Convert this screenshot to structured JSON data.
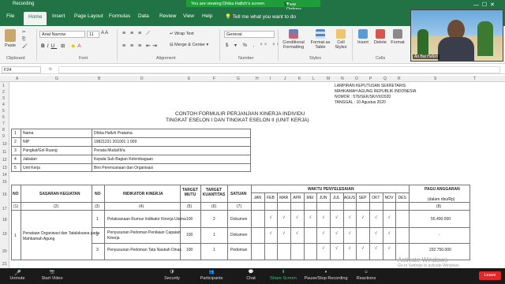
{
  "zoom": {
    "recording": "Recording",
    "banner": "You are viewing Dhika Hafizh's screen",
    "view_options": "View Options",
    "participant_name": "Ari Bai Hafizh",
    "toolbar": [
      "Unmute",
      "Start Video",
      "Security",
      "Participants",
      "Chat",
      "Share Screen",
      "Pause/Stop Recording",
      "Reactions"
    ],
    "participants_count": "1",
    "leave": "Leave"
  },
  "excel": {
    "tabs": [
      "File",
      "Home",
      "Insert",
      "Page Layout",
      "Formulas",
      "Data",
      "Review",
      "View",
      "Help"
    ],
    "tell_me": "Tell me what you want to do",
    "clipboard": {
      "paste": "Paste",
      "group": "Clipboard"
    },
    "font": {
      "name": "Arial Narrow",
      "size": "11",
      "group": "Font"
    },
    "alignment": {
      "wrap": "Wrap Text",
      "merge": "Merge & Center",
      "group": "Alignment"
    },
    "number": {
      "format": "General",
      "group": "Number"
    },
    "styles": {
      "cond": "Conditional Formatting",
      "table": "Format as Table",
      "cell": "Cell Styles",
      "group": "Styles"
    },
    "cells": {
      "insert": "Insert",
      "delete": "Delete",
      "format": "Format",
      "group": "Cells"
    },
    "namebox": "F24",
    "fx": "fx",
    "columns": [
      "A",
      "G",
      "B",
      "C",
      "D",
      "E",
      "F",
      "G",
      "H",
      "I",
      "J",
      "K",
      "L",
      "M",
      "N",
      "O",
      "P",
      "Q",
      "R",
      "S",
      "T",
      "U",
      "V"
    ],
    "rows": [
      "1",
      "2",
      "3",
      "4",
      "5",
      "6",
      "7",
      "8",
      "9",
      "10",
      "11",
      "12",
      "13",
      "14",
      "15",
      "16",
      "17",
      "18",
      "19",
      "20",
      "21"
    ]
  },
  "doc": {
    "lampiran": [
      "LAMPIRAN KEPUTUSAN SEKRETARIS",
      "MAHKAMAH AGUNG REPUBLIK INDONESIA",
      "NOMOR : 576/SEK/SK/VII/2020",
      "TANGGAL : 10 Agustus 2020"
    ],
    "title1": "CONTOH FORMULIR PERJANJIAN KINERJA INDIVIDU",
    "title2": "TINGKAT ESELON I DAN TINGKAT ESELON II (UNIT KERJA)",
    "info": [
      {
        "no": "1",
        "label": "Nama",
        "value": "Dhika Hafizh Pratama"
      },
      {
        "no": "2",
        "label": "NIP",
        "value": "19821231 201001 1 009"
      },
      {
        "no": "3",
        "label": "Pangkat/Gol Ruang",
        "value": "Penata Muda/III/a"
      },
      {
        "no": "4",
        "label": "Jabatan",
        "value": "Kepala Sub Bagian Kelembagaan"
      },
      {
        "no": "5",
        "label": "Unit Kerja",
        "value": "Biro Perencanaan dan Organisasi"
      }
    ],
    "headers": {
      "no": "NO",
      "sasaran": "SASARAN KEGIATAN",
      "no2": "NO",
      "indikator": "INDIKATOR KINERJA",
      "target_mutu": "TARGET MUTU",
      "target_kuantitas": "TARGET KUANTITAS",
      "satuan": "SATUAN",
      "waktu": "WAKTU PENYELESAIAN",
      "anggaran": "PAGU ANGGARAN",
      "anggaran_sub": "(dalam ribu/Rp)"
    },
    "months": [
      "JAN",
      "FEB",
      "MAR",
      "APR",
      "MEI",
      "JUN",
      "JUL",
      "AGUS",
      "SEP",
      "OKT",
      "NOV",
      "DES"
    ],
    "colnums": [
      "(1)",
      "(2)",
      "(3)",
      "(4)",
      "(5)",
      "(6)",
      "(7)",
      "(8)"
    ],
    "sasaran_text": [
      "Penataan Organisasi dan Tatalaksana pada",
      "Mahkamah Agung"
    ],
    "rows": [
      {
        "no": "1",
        "indikator": [
          "Pelaksanaan Rumus Indikator Kinerja Utama"
        ],
        "mutu": "100",
        "qty": "2",
        "satuan": "Dokumen",
        "anggaran": "55.400.000"
      },
      {
        "no": "2",
        "indikator": [
          "Penyusunan Pedoman Penilaian Capaian",
          "Kinerja"
        ],
        "mutu": "100",
        "qty": "1",
        "satuan": "Dokumen",
        "anggaran": "-"
      },
      {
        "no": "3",
        "indikator": [
          "Penyusunan Pedoman Tata Naskah Dinas"
        ],
        "mutu": "100",
        "qty": "1",
        "satuan": "Pedoman",
        "anggaran": "232.750.000"
      }
    ],
    "check": "√",
    "row_no": "1"
  },
  "windows": {
    "activate": "Activate Windows",
    "activate_sub": "Go to Settings to activate Windows."
  }
}
